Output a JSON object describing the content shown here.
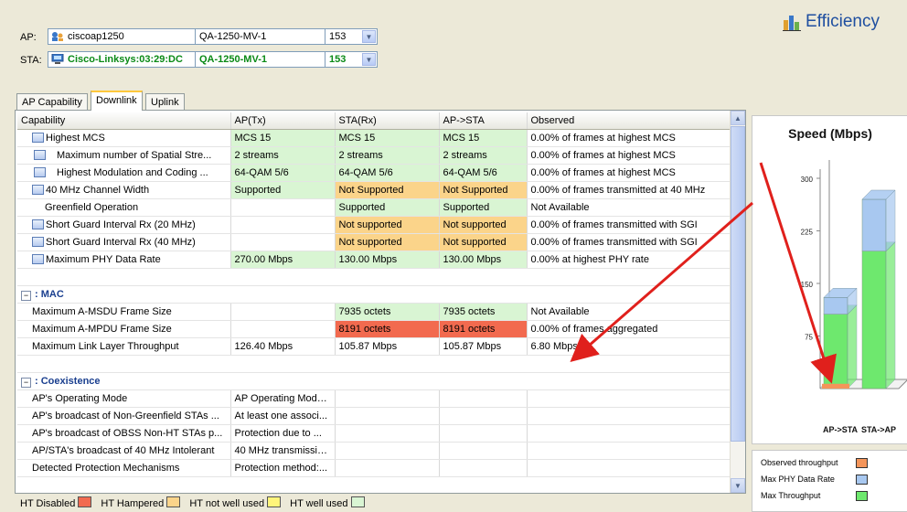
{
  "header": {
    "ap_label": "AP:",
    "sta_label": "STA:",
    "ap_device": "ciscoap1250",
    "ap_network": "QA-1250-MV-1",
    "ap_channel": "153",
    "sta_device": "Cisco-Linksys:03:29:DC",
    "sta_network": "QA-1250-MV-1",
    "sta_channel": "153",
    "efficiency_title": "Efficiency"
  },
  "tabs": [
    {
      "label": "AP Capability",
      "active": false
    },
    {
      "label": "Downlink",
      "active": true
    },
    {
      "label": "Uplink",
      "active": false
    }
  ],
  "table": {
    "columns": [
      "Capability",
      "AP(Tx)",
      "STA(Rx)",
      "AP->STA",
      "Observed"
    ],
    "rows": [
      {
        "icon": true,
        "indent": 0,
        "cells": [
          "Highest MCS",
          "MCS 15",
          "MCS 15",
          "MCS 15",
          "0.00% of frames at highest MCS"
        ],
        "colors": [
          "",
          "green",
          "green",
          "green",
          ""
        ]
      },
      {
        "icon": true,
        "indent": 1,
        "cells": [
          "Maximum number of Spatial Stre...",
          "2 streams",
          "2 streams",
          "2 streams",
          "0.00% of frames at highest MCS"
        ],
        "colors": [
          "",
          "green",
          "green",
          "green",
          ""
        ]
      },
      {
        "icon": true,
        "indent": 1,
        "cells": [
          "Highest Modulation and Coding ...",
          "64-QAM 5/6",
          "64-QAM 5/6",
          "64-QAM 5/6",
          "0.00% of frames at highest MCS"
        ],
        "colors": [
          "",
          "green",
          "green",
          "green",
          ""
        ]
      },
      {
        "icon": true,
        "indent": 0,
        "cells": [
          "40 MHz Channel Width",
          "Supported",
          "Not Supported",
          "Not Supported",
          "0.00% of frames transmitted at 40 MHz"
        ],
        "colors": [
          "",
          "green",
          "orange",
          "orange",
          ""
        ]
      },
      {
        "icon": false,
        "indent": 1,
        "cells": [
          "Greenfield Operation",
          "",
          "Supported",
          "Supported",
          "Not Available"
        ],
        "colors": [
          "",
          "",
          "green",
          "green",
          ""
        ]
      },
      {
        "icon": true,
        "indent": 0,
        "cells": [
          "Short Guard Interval Rx (20 MHz)",
          "",
          "Not supported",
          "Not supported",
          "0.00% of frames transmitted with SGI"
        ],
        "colors": [
          "",
          "",
          "orange",
          "orange",
          ""
        ]
      },
      {
        "icon": true,
        "indent": 0,
        "cells": [
          "Short Guard Interval Rx (40 MHz)",
          "",
          "Not supported",
          "Not supported",
          "0.00% of frames transmitted with SGI"
        ],
        "colors": [
          "",
          "",
          "orange",
          "orange",
          ""
        ]
      },
      {
        "icon": true,
        "indent": 0,
        "cells": [
          "Maximum PHY Data Rate",
          "270.00 Mbps",
          "130.00 Mbps",
          "130.00 Mbps",
          "0.00% at highest PHY rate"
        ],
        "colors": [
          "",
          "green",
          "green",
          "green",
          ""
        ]
      }
    ],
    "mac_title": ": MAC",
    "mac_rows": [
      {
        "cells": [
          "Maximum A-MSDU Frame Size",
          "",
          "7935 octets",
          "7935 octets",
          "Not Available"
        ],
        "colors": [
          "",
          "",
          "green",
          "green",
          ""
        ]
      },
      {
        "cells": [
          "Maximum A-MPDU Frame Size",
          "",
          "8191 octets",
          "8191 octets",
          "0.00% of frames aggregated"
        ],
        "colors": [
          "",
          "",
          "red",
          "red",
          ""
        ]
      },
      {
        "cells": [
          "Maximum Link Layer Throughput",
          "126.40 Mbps",
          "105.87 Mbps",
          "105.87 Mbps",
          "6.80 Mbps"
        ],
        "colors": [
          "",
          "",
          "",
          "",
          ""
        ]
      }
    ],
    "coex_title": ": Coexistence",
    "coex_rows": [
      {
        "cells": [
          "AP's Operating Mode",
          "AP Operating Mode...",
          "",
          "",
          ""
        ]
      },
      {
        "cells": [
          "AP's broadcast of Non-Greenfield STAs ...",
          "At least one associ...",
          "",
          "",
          ""
        ]
      },
      {
        "cells": [
          "AP's broadcast of OBSS Non-HT STAs p...",
          "Protection due to ...",
          "",
          "",
          ""
        ]
      },
      {
        "cells": [
          "AP/STA's broadcast of 40 MHz Intolerant",
          "40 MHz transmissio...",
          "",
          "",
          ""
        ]
      },
      {
        "cells": [
          "Detected Protection Mechanisms",
          "Protection method:...",
          "",
          "",
          ""
        ]
      }
    ]
  },
  "bottom_legend": [
    {
      "label": "HT Disabled",
      "color": "#f26a4f"
    },
    {
      "label": "HT Hampered",
      "color": "#fbd48a"
    },
    {
      "label": "HT not well used",
      "color": "#fff57a"
    },
    {
      "label": "HT well used",
      "color": "#d9f5d3"
    }
  ],
  "chart_data": {
    "type": "bar",
    "title": "Speed (Mbps)",
    "categories": [
      "AP->STA",
      "STA->AP"
    ],
    "ylim": [
      0,
      300
    ],
    "yticks": [
      75,
      150,
      225,
      300
    ],
    "series": [
      {
        "name": "Max Throughput",
        "values": [
          106,
          196
        ],
        "color": "#6ee86e"
      },
      {
        "name": "Max PHY Data Rate",
        "values": [
          130,
          270
        ],
        "color": "#a8c8f0"
      },
      {
        "name": "Observed throughput",
        "values": [
          6.8,
          0
        ],
        "color": "#f4955a"
      }
    ],
    "legend": [
      {
        "label": "Observed throughput",
        "color": "#f4955a"
      },
      {
        "label": "Max PHY Data Rate",
        "color": "#a8c8f0"
      },
      {
        "label": "Max Throughput",
        "color": "#6ee86e"
      }
    ]
  }
}
